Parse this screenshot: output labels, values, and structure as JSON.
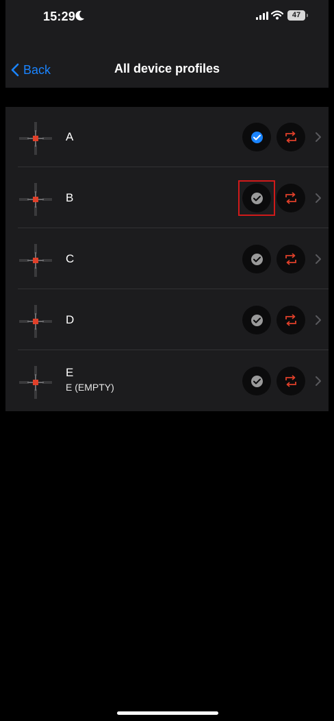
{
  "status_bar": {
    "time": "15:29",
    "battery": "47",
    "icons": [
      "moon-icon",
      "signal-bars-icon",
      "wifi-icon",
      "battery-icon"
    ]
  },
  "nav": {
    "back_label": "Back",
    "title": "All device profiles"
  },
  "profiles": [
    {
      "name": "A",
      "subtitle": "",
      "active": true
    },
    {
      "name": "B",
      "subtitle": "",
      "active": false
    },
    {
      "name": "C",
      "subtitle": "",
      "active": false
    },
    {
      "name": "D",
      "subtitle": "",
      "active": false
    },
    {
      "name": "E",
      "subtitle": "E (EMPTY)",
      "active": false
    }
  ],
  "colors": {
    "accent": "#1a84ff",
    "swap_icon": "#e0402a",
    "inactive_check": "#9a9a9a",
    "highlight_box": "#d11a1a"
  }
}
